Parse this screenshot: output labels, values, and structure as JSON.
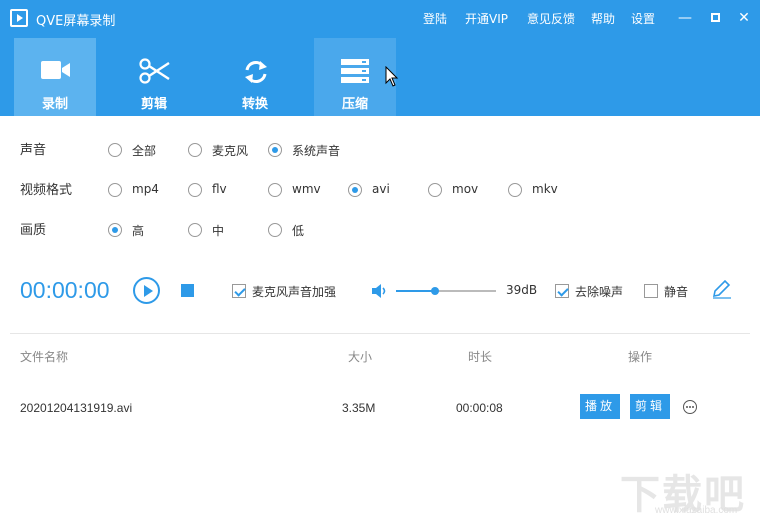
{
  "window": {
    "title": "QVE屏幕录制",
    "menu": [
      "登陆",
      "开通VIP",
      "意见反馈",
      "帮助",
      "设置"
    ],
    "controls": [
      "minimize",
      "maximize",
      "close"
    ]
  },
  "toolbar": {
    "tabs": [
      {
        "label": "录制",
        "icon": "camera-icon"
      },
      {
        "label": "剪辑",
        "icon": "scissors-icon"
      },
      {
        "label": "转换",
        "icon": "refresh-icon"
      },
      {
        "label": "压缩",
        "icon": "compress-icon"
      }
    ],
    "active": "录制"
  },
  "settings": {
    "audio": {
      "label": "声音",
      "options": [
        "全部",
        "麦克风",
        "系统声音"
      ],
      "selected": "系统声音"
    },
    "format": {
      "label": "视频格式",
      "options": [
        "mp4",
        "flv",
        "wmv",
        "avi",
        "mov",
        "mkv"
      ],
      "selected": "avi"
    },
    "quality": {
      "label": "画质",
      "options": [
        "高",
        "中",
        "低"
      ],
      "selected": "高"
    }
  },
  "recorder": {
    "timer": "00:00:00",
    "mic_boost": {
      "label": "麦克风声音加强",
      "checked": true
    },
    "volume": {
      "value_label": "39dB",
      "level": 0.39
    },
    "noise_removal": {
      "label": "去除噪声",
      "checked": true
    },
    "mute": {
      "label": "静音",
      "checked": false
    }
  },
  "files": {
    "headers": [
      "文件名称",
      "大小",
      "时长",
      "操作"
    ],
    "rows": [
      {
        "name": "20201204131919.avi",
        "size": "3.35M",
        "duration": "00:00:08",
        "actions": [
          "播放",
          "剪辑"
        ]
      }
    ]
  },
  "watermark": {
    "text": "下载吧",
    "sub": "www.xiazaiba.com"
  },
  "colors": {
    "accent": "#2e9ae8",
    "tab_active": "#5cb3ef"
  }
}
